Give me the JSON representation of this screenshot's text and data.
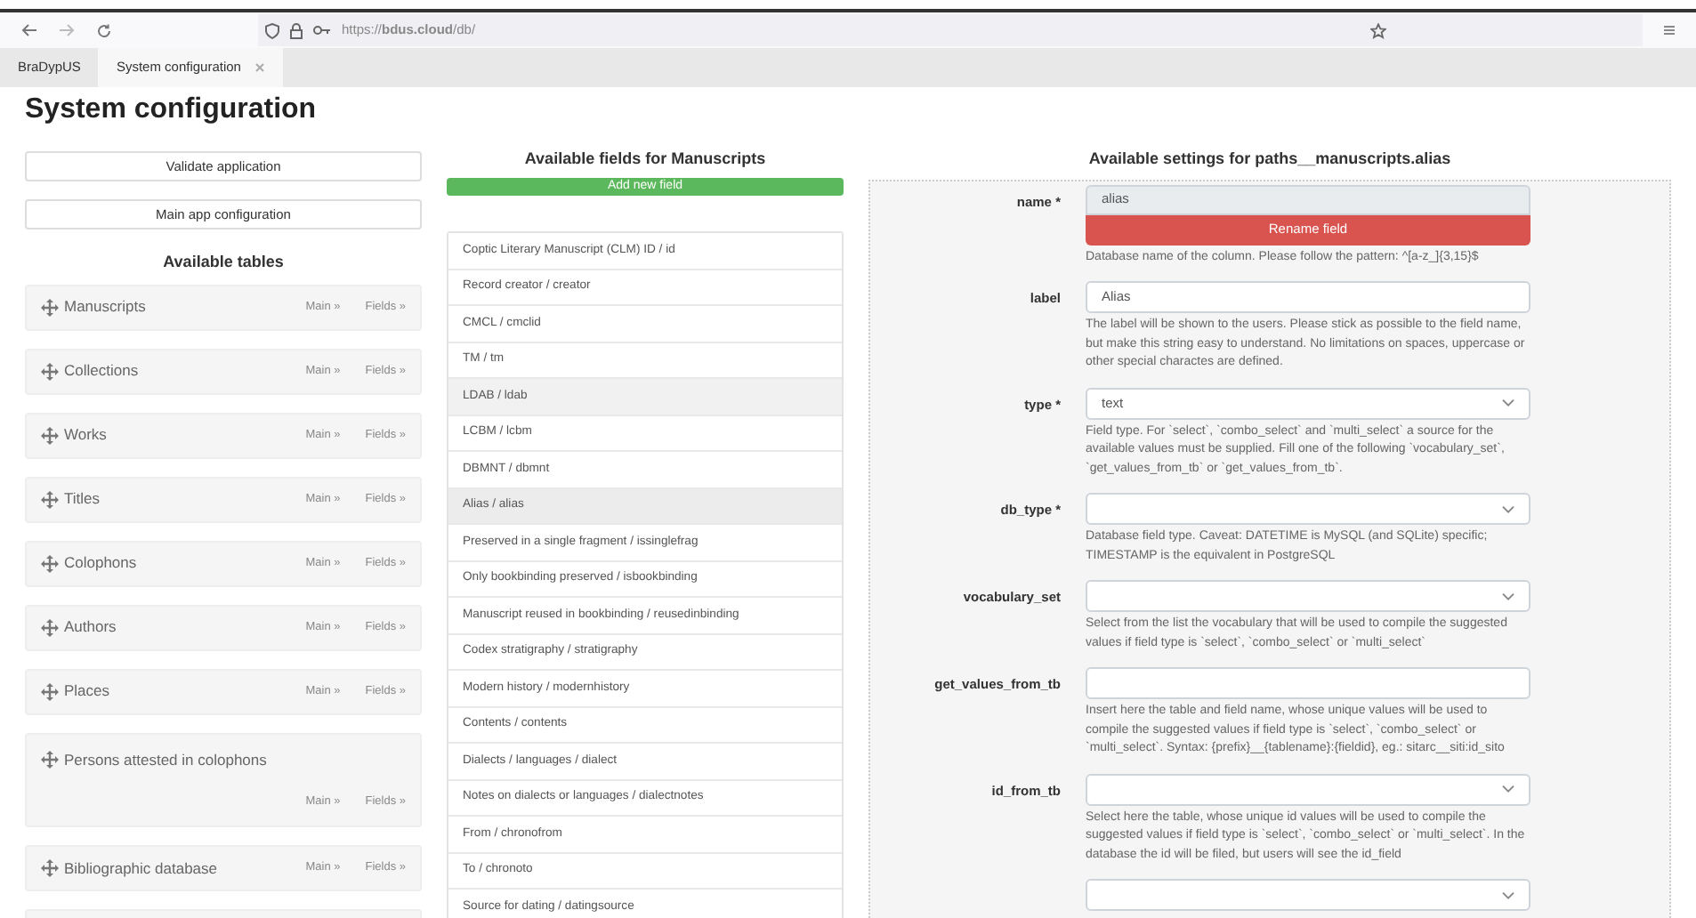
{
  "browser": {
    "url": "https://**bdus.cloud**/db/"
  },
  "tabs": [
    {
      "label": "BraDypUS",
      "selected": false,
      "closable": false
    },
    {
      "label": "System configuration",
      "selected": true,
      "closable": true
    }
  ],
  "page_title": "System configuration",
  "left": {
    "buttons": [
      "Validate application",
      "Main app configuration"
    ],
    "tables_heading": "Available tables",
    "tables": [
      {
        "name": "Manuscripts",
        "main": "Main »",
        "fields": "Fields »",
        "wrapped": false
      },
      {
        "name": "Collections",
        "main": "Main »",
        "fields": "Fields »",
        "wrapped": false
      },
      {
        "name": "Works",
        "main": "Main »",
        "fields": "Fields »",
        "wrapped": false
      },
      {
        "name": "Titles",
        "main": "Main »",
        "fields": "Fields »",
        "wrapped": false
      },
      {
        "name": "Colophons",
        "main": "Main »",
        "fields": "Fields »",
        "wrapped": false
      },
      {
        "name": "Authors",
        "main": "Main »",
        "fields": "Fields »",
        "wrapped": false
      },
      {
        "name": "Places",
        "main": "Main »",
        "fields": "Fields »",
        "wrapped": false
      },
      {
        "name": "Persons attested in colophons",
        "main": "Main »",
        "fields": "Fields »",
        "wrapped": true
      },
      {
        "name": "Bibliographic database",
        "main": "Main »",
        "fields": "Fields »",
        "wrapped": false
      }
    ]
  },
  "middle": {
    "heading": "Available fields for Manuscripts",
    "add_button": "Add new field",
    "fields": [
      {
        "label": "Coptic Literary Manuscript (CLM) ID / id",
        "selected": false,
        "hovered": false
      },
      {
        "label": "Record creator / creator",
        "selected": false,
        "hovered": false
      },
      {
        "label": "CMCL / cmclid",
        "selected": false,
        "hovered": false
      },
      {
        "label": "TM / tm",
        "selected": false,
        "hovered": false
      },
      {
        "label": "LDAB / ldab",
        "selected": false,
        "hovered": true
      },
      {
        "label": "LCBM / lcbm",
        "selected": false,
        "hovered": false
      },
      {
        "label": "DBMNT / dbmnt",
        "selected": false,
        "hovered": false
      },
      {
        "label": "Alias / alias",
        "selected": true,
        "hovered": false
      },
      {
        "label": "Preserved in a single fragment / issinglefrag",
        "selected": false,
        "hovered": false
      },
      {
        "label": "Only bookbinding preserved / isbookbinding",
        "selected": false,
        "hovered": false
      },
      {
        "label": "Manuscript reused in bookbinding / reusedinbinding",
        "selected": false,
        "hovered": false
      },
      {
        "label": "Codex stratigraphy / stratigraphy",
        "selected": false,
        "hovered": false
      },
      {
        "label": "Modern history / modernhistory",
        "selected": false,
        "hovered": false
      },
      {
        "label": "Contents / contents",
        "selected": false,
        "hovered": false
      },
      {
        "label": "Dialects / languages / dialect",
        "selected": false,
        "hovered": false
      },
      {
        "label": "Notes on dialects or languages / dialectnotes",
        "selected": false,
        "hovered": false
      },
      {
        "label": "From / chronofrom",
        "selected": false,
        "hovered": false
      },
      {
        "label": "To / chronoto",
        "selected": false,
        "hovered": false
      },
      {
        "label": "Source for dating / datingsource",
        "selected": false,
        "hovered": false
      }
    ]
  },
  "right": {
    "heading": "Available settings for paths__manuscripts.alias",
    "settings": [
      {
        "label": "name *",
        "kind": "readonly",
        "value": "alias",
        "button": "Rename field",
        "help": "Database name of the column. Please follow the pattern: ^[a-z_]{3,15}$"
      },
      {
        "label": "label",
        "kind": "text",
        "value": "Alias",
        "help": "The label will be shown to the users. Please stick as possible to the field name, but make this string easy to understand. No limitations on spaces, uppercase or other special charactes are defined."
      },
      {
        "label": "type *",
        "kind": "select",
        "value": "text",
        "help": "Field type. For `select`, `combo_select` and `multi_select` a source for the available values must be supplied. Fill one of the following `vocabulary_set`, `get_values_from_tb` or `get_values_from_tb`."
      },
      {
        "label": "db_type *",
        "kind": "select",
        "help": "Database field type. Caveat: DATETIME is MySQL (and SQLite) specific; TIMESTAMP is the equivalent in PostgreSQL"
      },
      {
        "label": "vocabulary_set",
        "kind": "select",
        "help": "Select from the list the vocabulary that will be used to compile the suggested values if field type is `select`, `combo_select` or `multi_select`"
      },
      {
        "label": "get_values_from_tb",
        "kind": "text",
        "help": "Insert here the table and field name, whose unique values will be used to compile the suggested values if field type is `select`, `combo_select` or `multi_select`. Syntax: {prefix}__{tablename}:{fieldid}, eg.: sitarc__siti:id_sito"
      },
      {
        "label": "id_from_tb",
        "kind": "select",
        "help": "Select here the table, whose unique id values will be used to compile the suggested values if field type is `select`, `combo_select` or `multi_select`. In the database the id will be filed, but users will see the id_field"
      },
      {
        "kind": "select"
      }
    ]
  }
}
